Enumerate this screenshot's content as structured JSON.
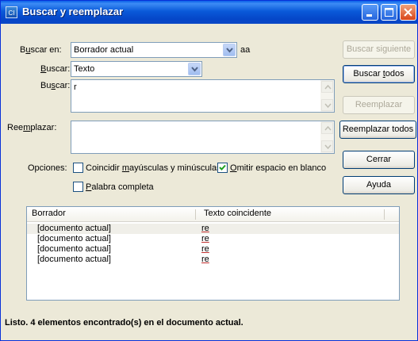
{
  "window": {
    "title": "Buscar y reemplazar",
    "icon": "app-icon"
  },
  "form": {
    "buscar_en": {
      "label_pre": "B",
      "label_acc": "u",
      "label_post": "scar en:",
      "value": "Borrador actual",
      "extra": "aa"
    },
    "buscar_tipo": {
      "label_pre": "",
      "label_acc": "B",
      "label_post": "uscar:",
      "value": "Texto"
    },
    "buscar_texto": {
      "label_pre": "Bu",
      "label_acc": "s",
      "label_post": "car:",
      "value": "r"
    },
    "reemplazar": {
      "label_pre": "Ree",
      "label_acc": "m",
      "label_post": "plazar:",
      "value": ""
    },
    "opciones": {
      "label": "Opciones:",
      "match_case": {
        "pre": "Coincidir ",
        "acc": "m",
        "post": "ayúsculas y minúsculas",
        "checked": false
      },
      "ignore_space": {
        "pre": "",
        "acc": "O",
        "post": "mitir espacio en blanco",
        "checked": true
      },
      "whole_word": {
        "pre": "",
        "acc": "P",
        "post": "alabra completa",
        "checked": false
      }
    }
  },
  "buttons": {
    "find_next": "Buscar siguiente",
    "find_all": {
      "pre": "Buscar ",
      "acc": "t",
      "post": "odos"
    },
    "replace": "Reemplazar",
    "replace_all": "Reemplazar todos",
    "close": "Cerrar",
    "help": "Ayuda"
  },
  "results": {
    "columns": [
      "Borrador",
      "Texto coincidente"
    ],
    "rows": [
      {
        "doc": "[documento actual]",
        "match": "re"
      },
      {
        "doc": "[documento actual]",
        "match": "re"
      },
      {
        "doc": "[documento actual]",
        "match": "re"
      },
      {
        "doc": "[documento actual]",
        "match": "re"
      }
    ]
  },
  "status": "Listo. 4 elementos encontrado(s) en el documento actual.",
  "colors": {
    "titlebar": "#0a5ad9",
    "dialog_bg": "#ece9d8",
    "border": "#7f9db9"
  }
}
